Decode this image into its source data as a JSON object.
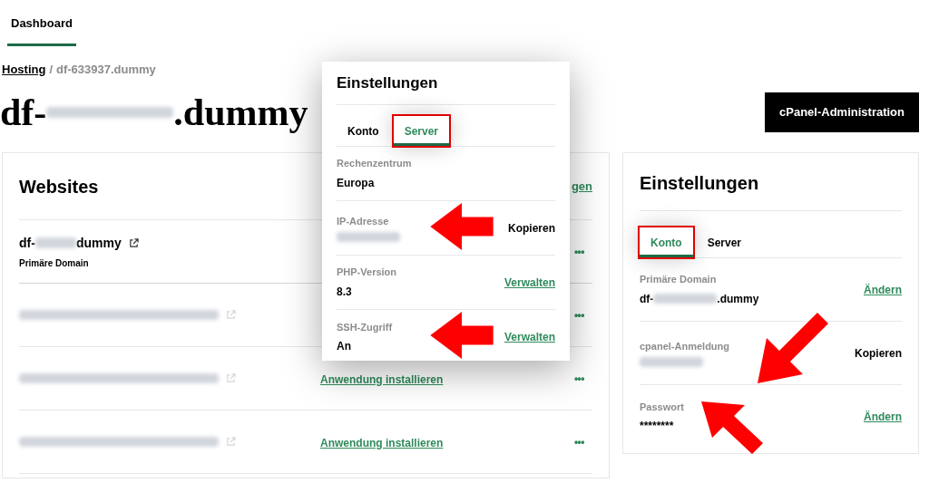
{
  "nav": {
    "tabs": [
      {
        "label": "Dashboard",
        "selected": true
      }
    ]
  },
  "breadcrumb": {
    "link": "Hosting",
    "separator": "/",
    "current": "df-633937.dummy"
  },
  "title": {
    "parts": [
      {
        "kind": "text",
        "text": "df-"
      },
      {
        "kind": "redacted"
      },
      {
        "kind": "text",
        "text": ".dummy"
      }
    ]
  },
  "header_button": "cPanel-Administration",
  "websites": {
    "title": "Websites",
    "header_link": "gen",
    "rows": [
      {
        "name": [
          {
            "kind": "text",
            "text": "df-"
          },
          {
            "kind": "redacted"
          },
          {
            "kind": "text",
            "text": "dummy"
          }
        ],
        "subtitle": "Primäre Domain",
        "blurred": false,
        "menu": "•••"
      },
      {
        "name": [
          {
            "kind": "redacted"
          }
        ],
        "blurred": true,
        "menu": "•••"
      },
      {
        "name": [
          {
            "kind": "redacted"
          }
        ],
        "blurred": true,
        "action": "Anwendung installieren",
        "menu": "•••"
      },
      {
        "name": [
          {
            "kind": "redacted"
          }
        ],
        "blurred": true,
        "action": "Anwendung installieren",
        "menu": "•••"
      }
    ]
  },
  "popup": {
    "title": "Einstellungen",
    "tabs": [
      {
        "label": "Konto",
        "selected": false,
        "highlighted": false
      },
      {
        "label": "Server",
        "selected": true,
        "highlighted": true
      }
    ],
    "rows": [
      {
        "label": "Rechenzentrum",
        "value": [
          {
            "kind": "text",
            "text": "Europa"
          }
        ]
      },
      {
        "label": "IP-Adresse",
        "value": [
          {
            "kind": "redacted"
          }
        ],
        "action": {
          "kind": "button",
          "text": "Kopieren"
        },
        "arrow": {
          "kind": "left"
        }
      },
      {
        "label": "PHP-Version",
        "value": [
          {
            "kind": "text",
            "text": "8.3"
          }
        ],
        "action": {
          "kind": "link",
          "text": "Verwalten"
        }
      },
      {
        "label": "SSH-Zugriff",
        "value": [
          {
            "kind": "text",
            "text": "An"
          }
        ],
        "action": {
          "kind": "link",
          "text": "Verwalten"
        },
        "arrow": {
          "kind": "left"
        }
      }
    ]
  },
  "settings": {
    "title": "Einstellungen",
    "tabs": [
      {
        "label": "Konto",
        "selected": true,
        "highlighted": true
      },
      {
        "label": "Server",
        "selected": false,
        "highlighted": false
      }
    ],
    "rows": [
      {
        "label": "Primäre Domain",
        "value": [
          {
            "kind": "text",
            "text": "df-"
          },
          {
            "kind": "redacted"
          },
          {
            "kind": "text",
            "text": ".dummy"
          }
        ],
        "action": {
          "kind": "link",
          "text": "Ändern"
        }
      },
      {
        "label": "cpanel-Anmeldung",
        "value": [
          {
            "kind": "redacted"
          }
        ],
        "action": {
          "kind": "button",
          "text": "Kopieren"
        },
        "arrow": {
          "kind": "down-left"
        }
      },
      {
        "label": "Passwort",
        "value": [
          {
            "kind": "text",
            "text": "********"
          }
        ],
        "action": {
          "kind": "link",
          "text": "Ändern"
        },
        "arrow": {
          "kind": "up-left"
        }
      }
    ]
  }
}
